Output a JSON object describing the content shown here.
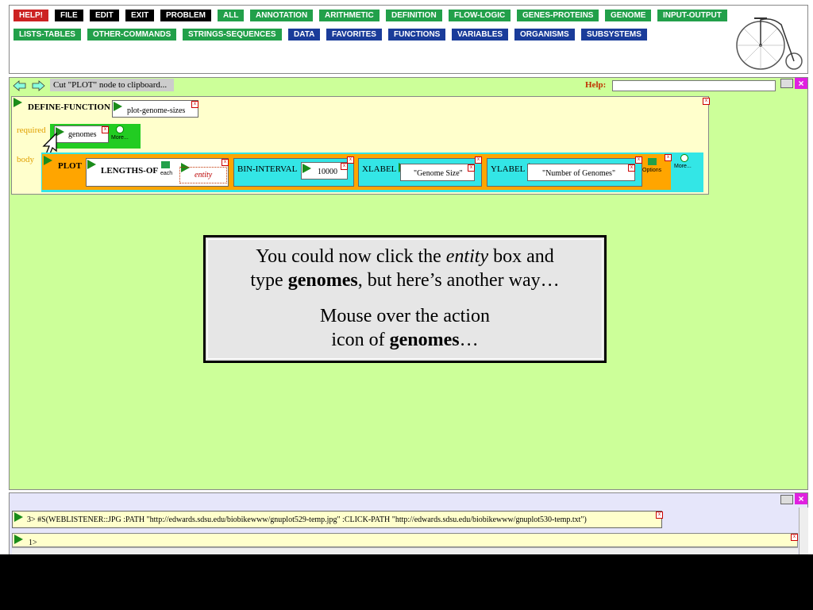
{
  "menu": {
    "row1": [
      {
        "label": "HELP!",
        "color": "red"
      },
      {
        "label": "FILE",
        "color": "black"
      },
      {
        "label": "EDIT",
        "color": "black"
      },
      {
        "label": "EXIT",
        "color": "black"
      },
      {
        "label": "PROBLEM",
        "color": "black"
      },
      {
        "label": "ALL",
        "color": "green"
      },
      {
        "label": "ANNOTATION",
        "color": "green"
      },
      {
        "label": "ARITHMETIC",
        "color": "green"
      },
      {
        "label": "DEFINITION",
        "color": "green"
      },
      {
        "label": "FLOW-LOGIC",
        "color": "green"
      },
      {
        "label": "GENES-PROTEINS",
        "color": "green"
      },
      {
        "label": "GENOME",
        "color": "green"
      },
      {
        "label": "INPUT-OUTPUT",
        "color": "green"
      }
    ],
    "row2": [
      {
        "label": "LISTS-TABLES",
        "color": "green"
      },
      {
        "label": "OTHER-COMMANDS",
        "color": "green"
      },
      {
        "label": "STRINGS-SEQUENCES",
        "color": "green"
      },
      {
        "label": "DATA",
        "color": "blue"
      },
      {
        "label": "FAVORITES",
        "color": "blue"
      },
      {
        "label": "FUNCTIONS",
        "color": "blue"
      },
      {
        "label": "VARIABLES",
        "color": "blue"
      },
      {
        "label": "ORGANISMS",
        "color": "blue"
      },
      {
        "label": "SUBSYSTEMS",
        "color": "blue"
      }
    ]
  },
  "toolbar": {
    "status": "Cut \"PLOT\" node to clipboard...",
    "help_label": "Help:",
    "help_value": ""
  },
  "define": {
    "keyword": "DEFINE-FUNCTION",
    "name": "plot-genome-sizes",
    "required_label": "required",
    "param": "genomes",
    "more_label": "More...",
    "body_label": "body",
    "plot": "PLOT",
    "lengths_of": "LENGTHS-OF",
    "each": "each",
    "entity": "entity",
    "bin_interval": "BIN-INTERVAL",
    "bin_value": "10000",
    "xlabel": "XLABEL",
    "xlabel_value": "\"Genome Size\"",
    "ylabel": "YLABEL",
    "ylabel_value": "\"Number of Genomes\"",
    "options": "Options",
    "more2": "More..."
  },
  "popup": {
    "line1_pre": "You could now click the ",
    "line1_em": "entity",
    "line1_post": " box and",
    "line2_pre": "type ",
    "line2_bold": "genomes",
    "line2_post": ", but here’s another way…",
    "line3": "Mouse over the action",
    "line4_pre": "icon of ",
    "line4_bold": "genomes",
    "line4_post": "…"
  },
  "output": {
    "result_line": "3>  #S(WEBLISTENER::JPG :PATH \"http://edwards.sdsu.edu/biobikewww/gnuplot529-temp.jpg\" :CLICK-PATH \"http://edwards.sdsu.edu/biobikewww/gnuplot530-temp.txt\")",
    "prompt": "1>"
  },
  "colors": {
    "workspace": "#ccff99",
    "define_box": "#ffffcc",
    "plot_box": "#ffa500",
    "cyan_body": "#33e6e6",
    "param_box": "#22cc22"
  }
}
